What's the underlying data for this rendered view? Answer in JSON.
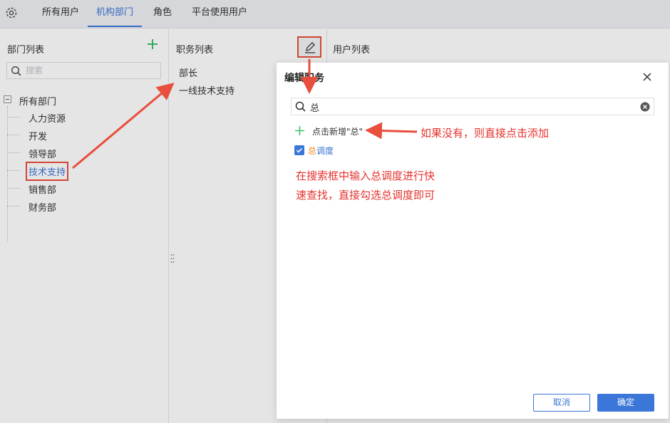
{
  "top_nav": {
    "settings_icon": "gear-icon",
    "tabs": [
      {
        "label": "所有用户",
        "active": false
      },
      {
        "label": "机构部门",
        "active": true
      },
      {
        "label": "角色",
        "active": false
      },
      {
        "label": "平台使用用户",
        "active": false
      }
    ]
  },
  "dept_panel": {
    "title": "部门列表",
    "search_placeholder": "搜索",
    "root": "所有部门",
    "departments": [
      "人力资源",
      "开发",
      "领导部",
      "技术支持",
      "销售部",
      "财务部"
    ],
    "selected": "技术支持"
  },
  "post_panel": {
    "title": "职务列表",
    "items": [
      "部长",
      "一线技术支持"
    ]
  },
  "user_panel": {
    "title": "用户列表"
  },
  "dialog": {
    "title": "编辑职务",
    "search_value": "总",
    "add_new_text": "点击新增\"总\"",
    "results": [
      {
        "highlight": "总",
        "rest": "调度",
        "checked": true
      }
    ],
    "cancel_label": "取消",
    "ok_label": "确定"
  },
  "annotations": {
    "right_note": "如果没有，则直接点击添加",
    "body_line1": "在搜索框中输入总调度进行快",
    "body_line2": "速查找，直接勾选总调度即可"
  },
  "colors": {
    "accent": "#3b77d8",
    "annotation_red": "#e5322d",
    "match_highlight": "#f08a1c",
    "add_green": "#3fbf6a"
  }
}
